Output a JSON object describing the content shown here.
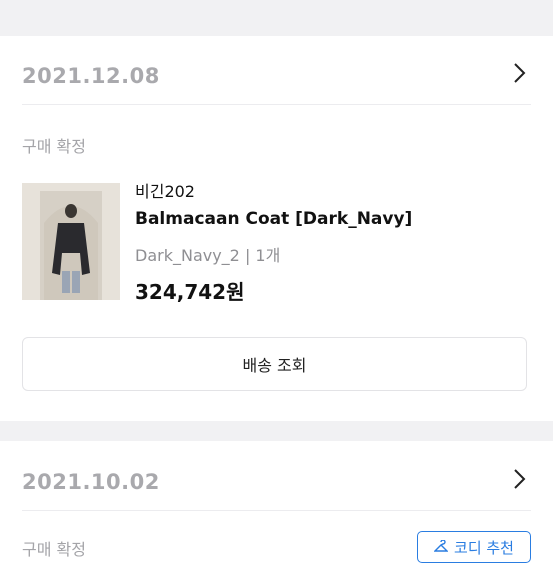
{
  "orders": [
    {
      "date": "2021.12.08",
      "status": "구매 확정",
      "item": {
        "brand": "비긴202",
        "name": "Balmacaan Coat [Dark_Navy]",
        "option": "Dark_Navy_2 | 1개",
        "price": "324,742원"
      },
      "action_label": "배송 조회"
    },
    {
      "date": "2021.10.02",
      "status": "구매 확정",
      "coordi_label": "코디 추천"
    }
  ],
  "icons": {
    "chevron": "chevron-right-icon",
    "coordi": "hanger-icon"
  },
  "colors": {
    "accent": "#2a7de1",
    "date_gray": "#a9a9ad",
    "section_gap": "#f1f1f3"
  }
}
